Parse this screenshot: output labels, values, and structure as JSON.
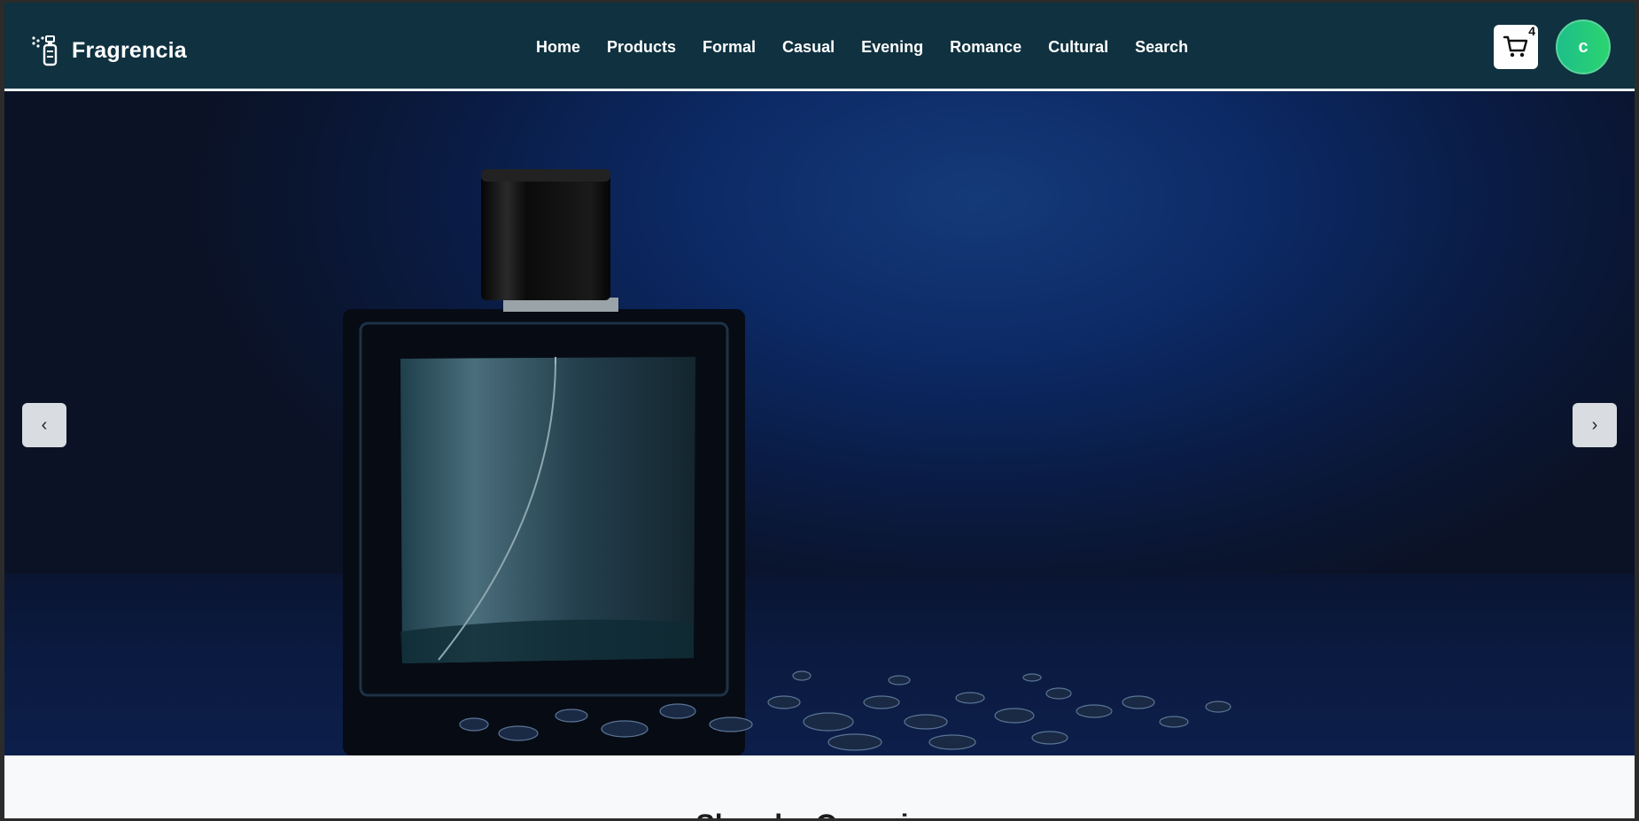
{
  "brand": {
    "name": "Fragrencia",
    "icon": "perfume-spray-icon"
  },
  "nav": {
    "links": [
      "Home",
      "Products",
      "Formal",
      "Casual",
      "Evening",
      "Romance",
      "Cultural",
      "Search"
    ]
  },
  "cart": {
    "icon": "cart-icon",
    "count": "4"
  },
  "user": {
    "initial": "c",
    "avatar_color": "#22c77e"
  },
  "carousel": {
    "prev_icon": "chevron-left-icon",
    "next_icon": "chevron-right-icon",
    "prev_glyph": "‹",
    "next_glyph": "›"
  },
  "section": {
    "title": "Shop by Occasion"
  },
  "colors": {
    "navbar": "#0f3140",
    "hero_bg": "#0c2a66",
    "page_bg": "#f7f9fb"
  }
}
